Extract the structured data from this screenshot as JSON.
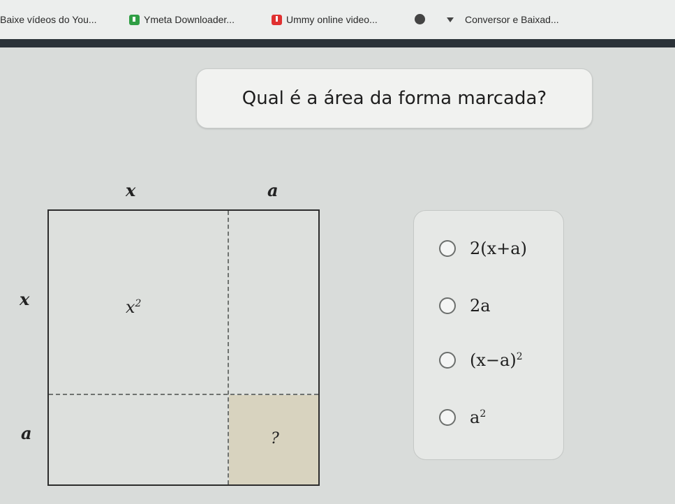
{
  "bookmarks": [
    {
      "label": "Baixe vídeos do You...",
      "icon": "bookmark-icon"
    },
    {
      "label": "Ymeta Downloader...",
      "icon": "green-download-icon"
    },
    {
      "label": "Ummy online video...",
      "icon": "red-download-icon"
    },
    {
      "label": "Conversor e Baixad...",
      "icon": "dropdown-triangle-icon"
    }
  ],
  "question": "Qual é a área da forma marcada?",
  "diagram": {
    "top_x": "x",
    "top_a": "a",
    "left_x": "x",
    "left_a": "a",
    "x2_base": "x",
    "x2_exp": "2",
    "unknown": "?",
    "shaded_color": "#d8d3bf"
  },
  "options": [
    {
      "text": "2(x+a)"
    },
    {
      "text": "2a"
    },
    {
      "base": "(x−a)",
      "exp": "2"
    },
    {
      "base": "a",
      "exp": "2"
    }
  ]
}
